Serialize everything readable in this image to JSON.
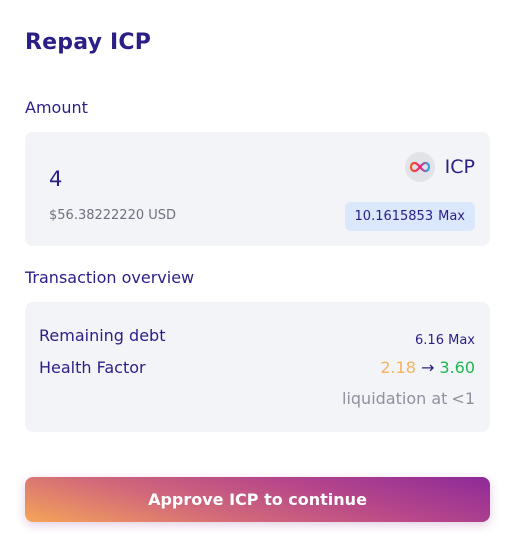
{
  "modal": {
    "title": "Repay ICP"
  },
  "amount": {
    "label": "Amount",
    "value": "4",
    "usd_value": "$56.38222220 USD",
    "token": "ICP",
    "token_icon": "infinity-icon",
    "balance": "10.1615853",
    "max_label": "Max"
  },
  "overview": {
    "label": "Transaction overview",
    "remaining_debt_label": "Remaining debt",
    "remaining_debt_value": "6.16",
    "remaining_debt_max": "Max",
    "health_factor_label": "Health Factor",
    "health_from": "2.18",
    "health_arrow": "→",
    "health_to": "3.60",
    "liquidation_label": "liquidation at",
    "liquidation_value": "<1",
    "colors": {
      "health_from": "#f5b25f",
      "health_to": "#20b852"
    }
  },
  "action": {
    "approve_label": "Approve ICP to continue"
  }
}
